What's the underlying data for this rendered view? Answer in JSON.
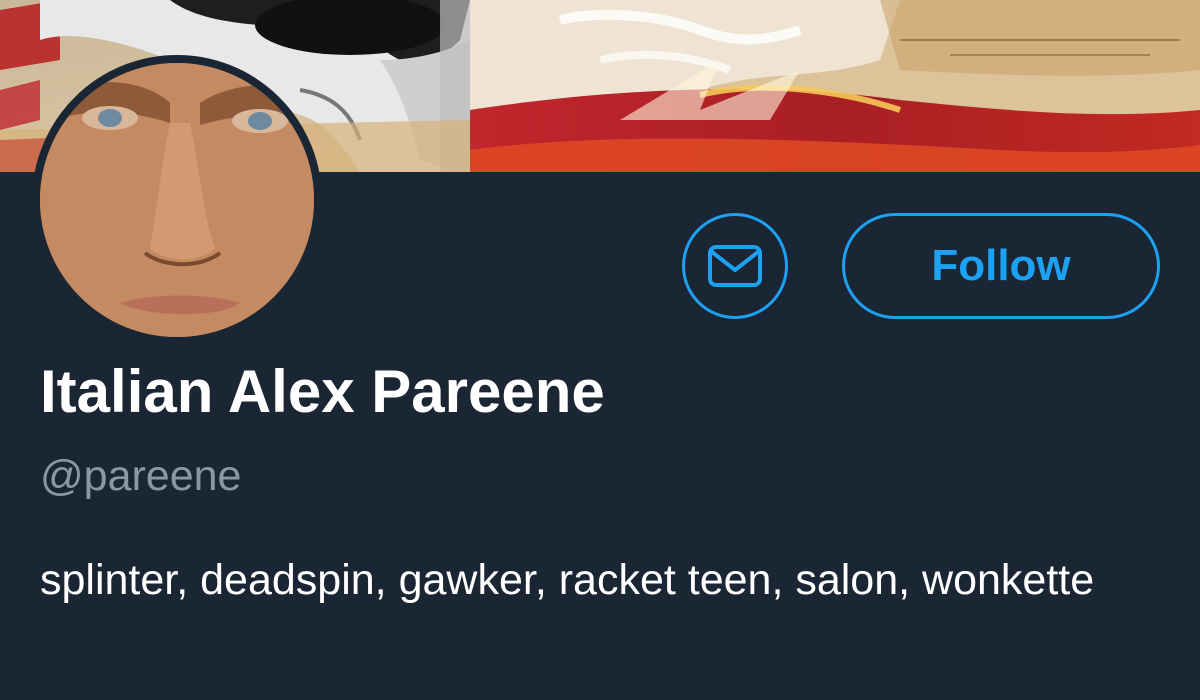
{
  "profile": {
    "display_name": "Italian Alex Pareene",
    "handle": "@pareene",
    "bio": "splinter, deadspin, gawker, racket teen, salon, wonkette"
  },
  "actions": {
    "message_icon": "envelope-icon",
    "follow_label": "Follow"
  },
  "colors": {
    "background": "#1b2634",
    "accent": "#1da1f2",
    "secondary_text": "#8899a6",
    "primary_text": "#ffffff"
  }
}
